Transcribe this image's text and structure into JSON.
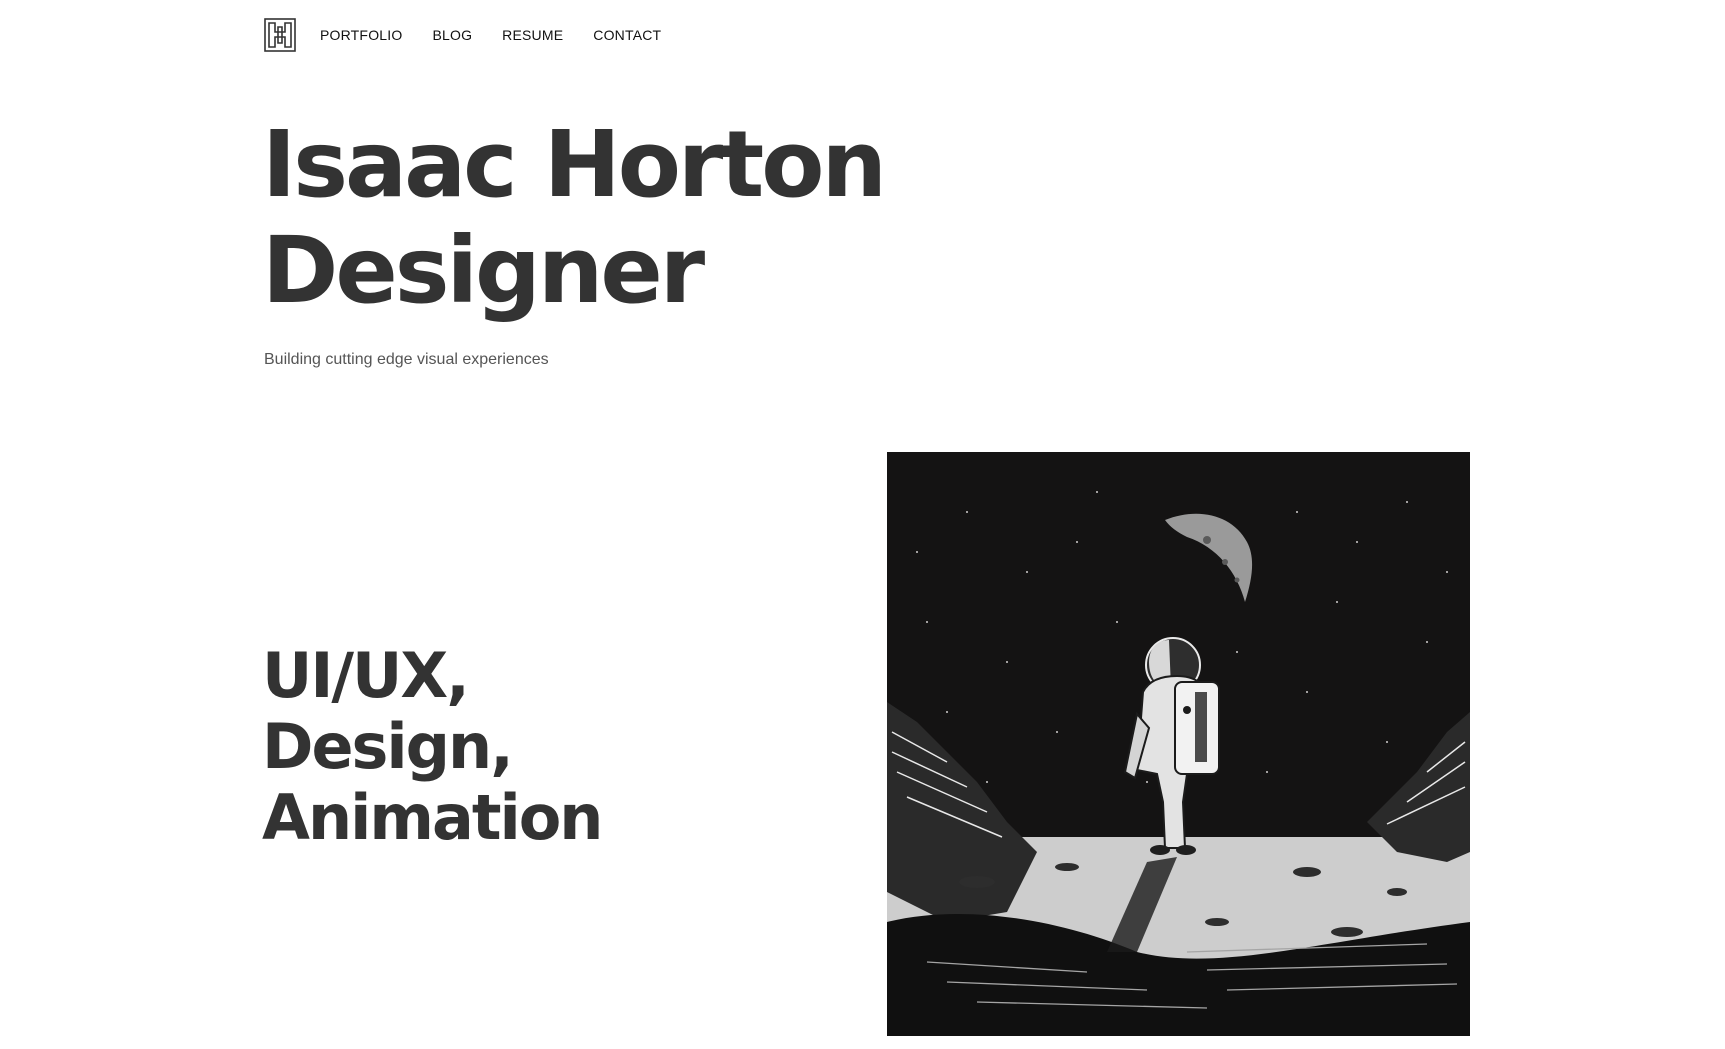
{
  "nav": {
    "logo_icon": "monogram-logo-icon",
    "links": [
      "PORTFOLIO",
      "BLOG",
      "RESUME",
      "CONTACT"
    ]
  },
  "hero": {
    "title_line1": "Isaac Horton",
    "title_line2": "Designer",
    "tagline": "Building cutting edge visual experiences"
  },
  "services": {
    "lines": [
      "UI/UX,",
      "Design,",
      "Animation"
    ]
  },
  "artwork": {
    "icon": "astronaut-on-moon-illustration"
  },
  "colors": {
    "text": "#333333",
    "background": "#ffffff",
    "artwork_bg": "#141313"
  }
}
